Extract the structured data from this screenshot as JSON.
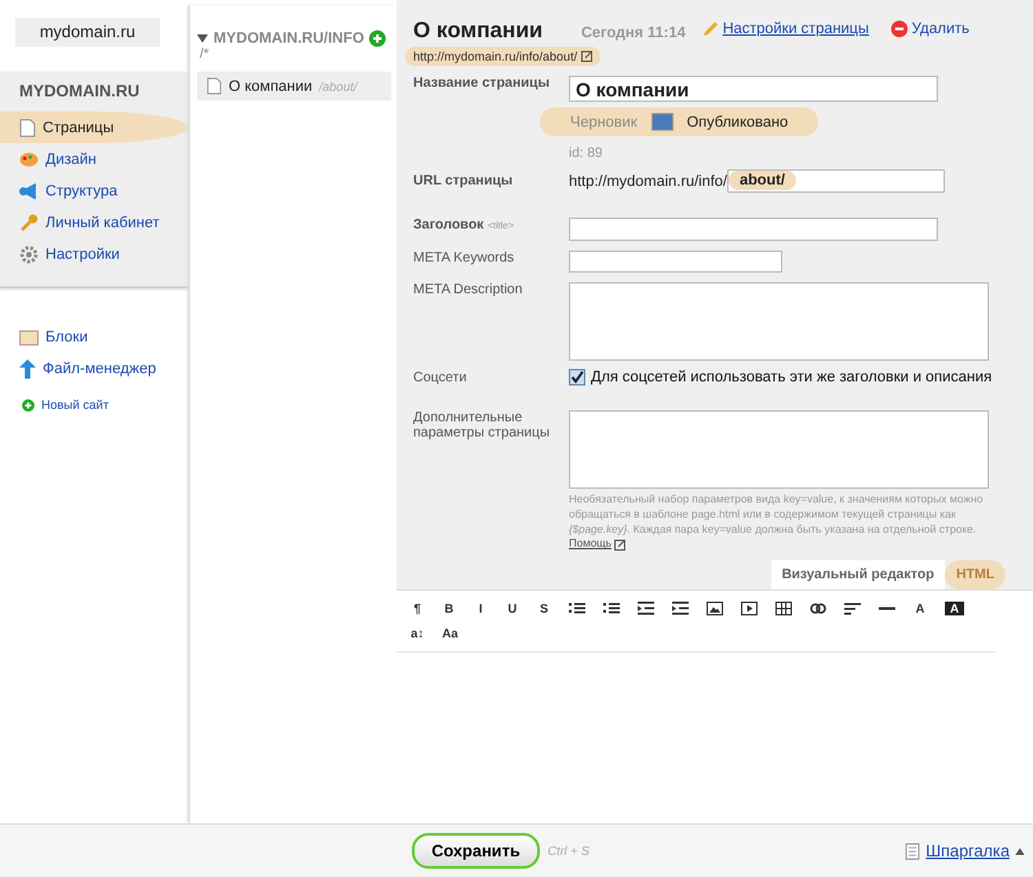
{
  "site_button": "mydomain.ru",
  "sidebar": {
    "title": "MYDOMAIN.RU",
    "items": [
      {
        "label": "Страницы",
        "kind": "page",
        "selected": true
      },
      {
        "label": "Дизайн",
        "kind": "design",
        "selected": false
      },
      {
        "label": "Структура",
        "kind": "structure",
        "selected": false
      },
      {
        "label": "Личный кабинет",
        "kind": "key",
        "selected": false
      },
      {
        "label": "Настройки",
        "kind": "gear",
        "selected": false
      }
    ],
    "extra_items": [
      {
        "label": "Блоки",
        "kind": "blocks"
      },
      {
        "label": "Файл-менеджер",
        "kind": "upload"
      }
    ],
    "new_site": "Новый сайт"
  },
  "tree": {
    "title": "MYDOMAIN.RU/INFO",
    "suffix": "/*",
    "expanded": true,
    "children": [
      {
        "label": "О компании",
        "path": "/about/",
        "selected": true
      }
    ]
  },
  "page": {
    "title": "О компании",
    "time": "Сегодня 11:14",
    "settings_link": "Настройки страницы",
    "delete_link": "Удалить",
    "url": "http://mydomain.ru/info/about/"
  },
  "form": {
    "name_label": "Название страницы",
    "name_value": "О компании",
    "status": {
      "draft": "Черновик",
      "published": "Опубликовано",
      "on": true
    },
    "id": "id: 89",
    "url_label": "URL страницы",
    "url_prefix": "http://mydomain.ru/info/",
    "url_value": "about/",
    "title_label": "Заголовок",
    "title_tag": "<title>",
    "keywords_label": "META Keywords",
    "description_label": "META Description",
    "social_label": "Соцсети",
    "social_checked": true,
    "social_text": "Для соцсетей использовать эти же заголовки и описания",
    "params_label": "Дополнительные параметры страницы",
    "params_hint": "Необязательный набор параметров вида key=value, к значениям которых можно обращаться в шаблоне page.html или в содержимом текущей страницы как *{$page.key}*. Каждая пара key=value должна быть указана на отдельной строке.",
    "help_link": "Помощь"
  },
  "editor": {
    "tabs": [
      {
        "label": "Визуальный редактор",
        "selected": false
      },
      {
        "label": "HTML",
        "selected": true
      }
    ],
    "toolbar": [
      {
        "kind": "text",
        "label": "¶"
      },
      {
        "kind": "text",
        "label": "B"
      },
      {
        "kind": "text",
        "label": "I"
      },
      {
        "kind": "text",
        "label": "U"
      },
      {
        "kind": "text",
        "label": "S"
      },
      {
        "kind": "bullets"
      },
      {
        "kind": "numbers"
      },
      {
        "kind": "outdent"
      },
      {
        "kind": "indent"
      },
      {
        "kind": "image"
      },
      {
        "kind": "video"
      },
      {
        "kind": "table"
      },
      {
        "kind": "link"
      },
      {
        "kind": "align"
      },
      {
        "kind": "rule"
      },
      {
        "kind": "text",
        "label": "A"
      },
      {
        "kind": "inverse",
        "label": "A"
      },
      {
        "kind": "text",
        "label": "a↕"
      },
      {
        "kind": "text",
        "label": "Aa"
      }
    ]
  },
  "footer": {
    "save": "Сохранить",
    "shortcut": "Ctrl + S",
    "cheatsheet": "Шпаргалка"
  }
}
